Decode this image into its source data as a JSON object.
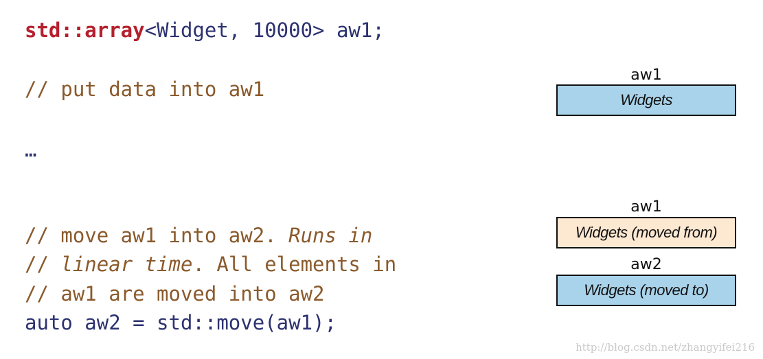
{
  "code": {
    "line1": {
      "keyword": "std::array",
      "rest": "<Widget, 10000> aw1;"
    },
    "line2": "// put data into aw1",
    "line3": "…",
    "line4": {
      "normal": "// move aw1 into aw2. ",
      "italic": "Runs in"
    },
    "line5": {
      "prefix": "// ",
      "italic": "linear time",
      "rest": ". All elements in"
    },
    "line6": "// aw1 are moved into aw2",
    "line7": "auto aw2 = std::move(aw1);"
  },
  "diagram": {
    "state1": {
      "label": "aw1",
      "box_text": "Widgets",
      "fill": "#a9d3ea"
    },
    "state2_from": {
      "label": "aw1",
      "box_text": "Widgets (moved from)",
      "fill": "#fde8d2"
    },
    "state2_to": {
      "label": "aw2",
      "box_text": "Widgets (moved to)",
      "fill": "#a9d3ea"
    }
  },
  "watermark": "http://blog.csdn.net/zhangyifei216"
}
